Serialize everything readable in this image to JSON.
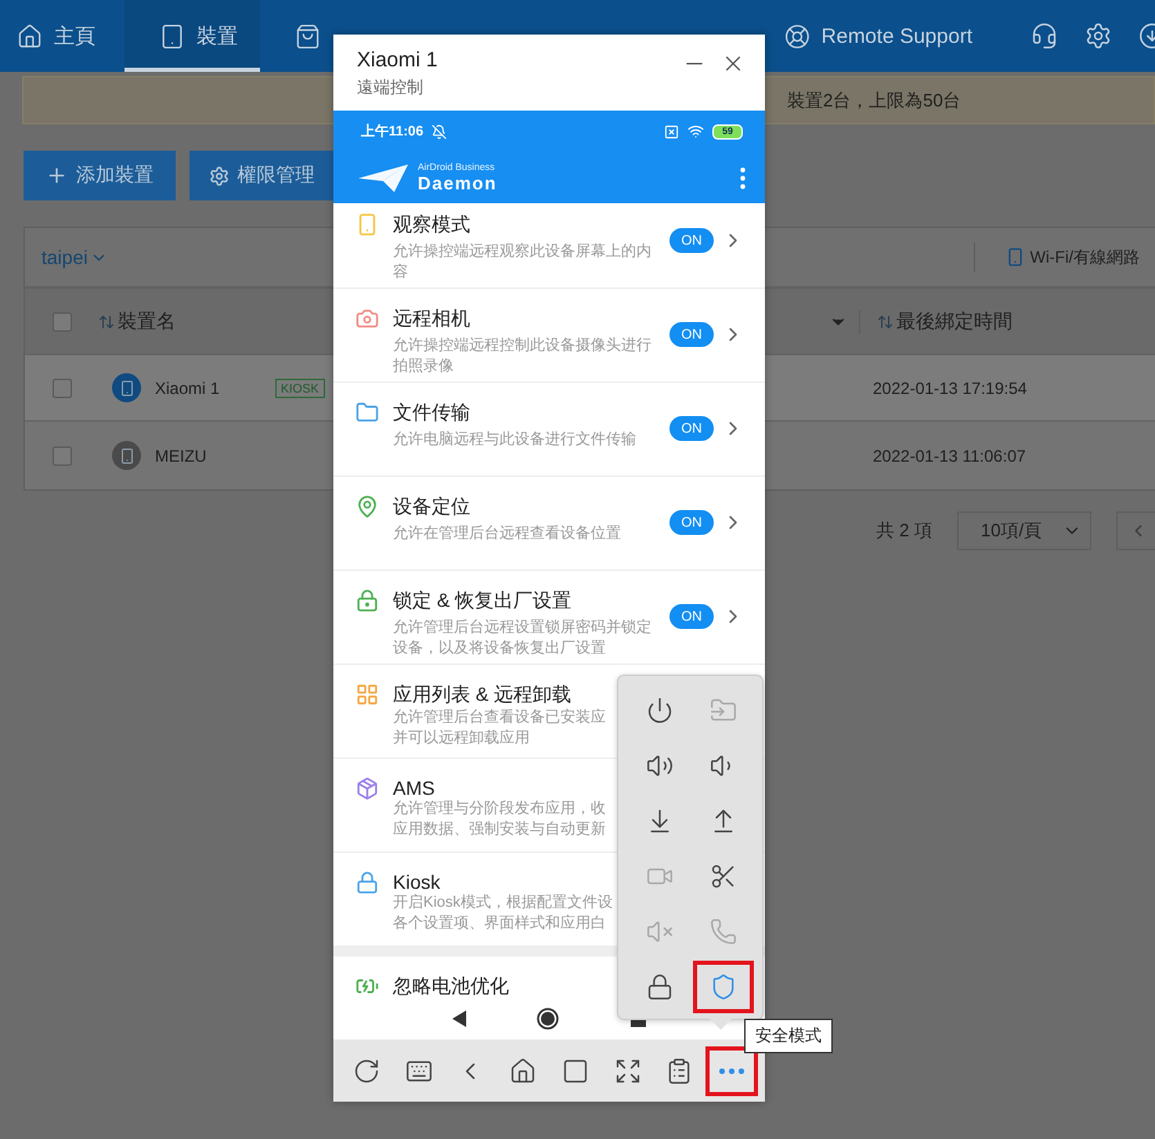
{
  "nav": {
    "items": [
      {
        "label": "主頁",
        "selected": false
      },
      {
        "label": "裝置",
        "selected": true
      },
      {
        "selected": false
      },
      {
        "label": "Remote Support",
        "selected": false
      }
    ]
  },
  "banner": {
    "text": "裝置2台，上限為50台"
  },
  "actions": [
    {
      "label": "添加裝置"
    },
    {
      "label": "權限管理"
    }
  ],
  "filter": {
    "group": "taipei",
    "network": "Wi-Fi/有線網路"
  },
  "table": {
    "select_all": {
      "checked": false
    },
    "columns": [
      {
        "label": "裝置名"
      },
      {
        "label": "最後綁定時間"
      }
    ],
    "rows": [
      {
        "name": "Xiaomi 1",
        "tag": "KIOSK",
        "online": true,
        "checked": false,
        "bound": "2022-01-13 17:19:54"
      },
      {
        "name": "MEIZU",
        "online": false,
        "checked": false,
        "bound": "2022-01-13 11:06:07"
      }
    ]
  },
  "pagination": {
    "total": "共 2 項",
    "page_size": "10項/頁"
  },
  "modal": {
    "title": "Xiaomi 1",
    "subtitle": "遠端控制",
    "phone": {
      "time": "上午11:06",
      "battery": "59",
      "brand": "AirDroid Business",
      "app": "Daemon",
      "features": [
        {
          "title": "观察模式",
          "desc": "允许操控端远程观察此设备屏幕上的内容",
          "toggle": "ON",
          "on": true,
          "color": "#f5c542"
        },
        {
          "title": "远程相机",
          "desc": "允许操控端远程控制此设备摄像头进行拍照录像",
          "toggle": "ON",
          "on": true,
          "color": "#f08c84"
        },
        {
          "title": "文件传输",
          "desc": "允许电脑远程与此设备进行文件传输",
          "toggle": "ON",
          "on": true,
          "color": "#4aa3e8"
        },
        {
          "title": "设备定位",
          "desc": "允许在管理后台远程查看设备位置",
          "toggle": "ON",
          "on": true,
          "color": "#4cb050"
        },
        {
          "title": "锁定 & 恢复出厂设置",
          "desc": "允许管理后台远程设置锁屏密码并锁定设备，以及将设备恢复出厂设置",
          "toggle": "ON",
          "on": true,
          "color": "#4cb050"
        },
        {
          "title": "应用列表 & 远程卸载",
          "desc_lines": [
            "允许管理后台查看设备已安装应",
            "并可以远程卸载应用"
          ],
          "color": "#f5a742"
        },
        {
          "title": "AMS",
          "desc_lines": [
            "允许管理与分阶段发布应用，收",
            "应用数据、强制安装与自动更新"
          ],
          "color": "#9a80e8"
        },
        {
          "title": "Kiosk",
          "desc_lines": [
            "开启Kiosk模式，根据配置文件设",
            "各个设置项、界面样式和应用白"
          ],
          "color": "#4aa3e8"
        },
        {
          "title": "忽略电池优化",
          "color": "#4cb050"
        }
      ]
    },
    "tools": [
      {
        "highlighted": false
      },
      {
        "highlighted": false
      },
      {
        "highlighted": false
      },
      {
        "highlighted": false
      },
      {
        "highlighted": false
      },
      {
        "highlighted": false
      },
      {
        "highlighted": false
      },
      {
        "highlighted": true
      }
    ],
    "menu": [
      {
        "disabled": false,
        "highlighted": false
      },
      {
        "disabled": true,
        "highlighted": false
      },
      {
        "disabled": false,
        "highlighted": false
      },
      {
        "disabled": false,
        "highlighted": false
      },
      {
        "disabled": false,
        "highlighted": false
      },
      {
        "disabled": false,
        "highlighted": false
      },
      {
        "disabled": true,
        "highlighted": false
      },
      {
        "disabled": false,
        "highlighted": false
      },
      {
        "disabled": true,
        "highlighted": false
      },
      {
        "disabled": true,
        "highlighted": false
      },
      {
        "disabled": false,
        "highlighted": false
      },
      {
        "disabled": false,
        "highlighted": true
      }
    ],
    "tooltip": "安全模式"
  }
}
